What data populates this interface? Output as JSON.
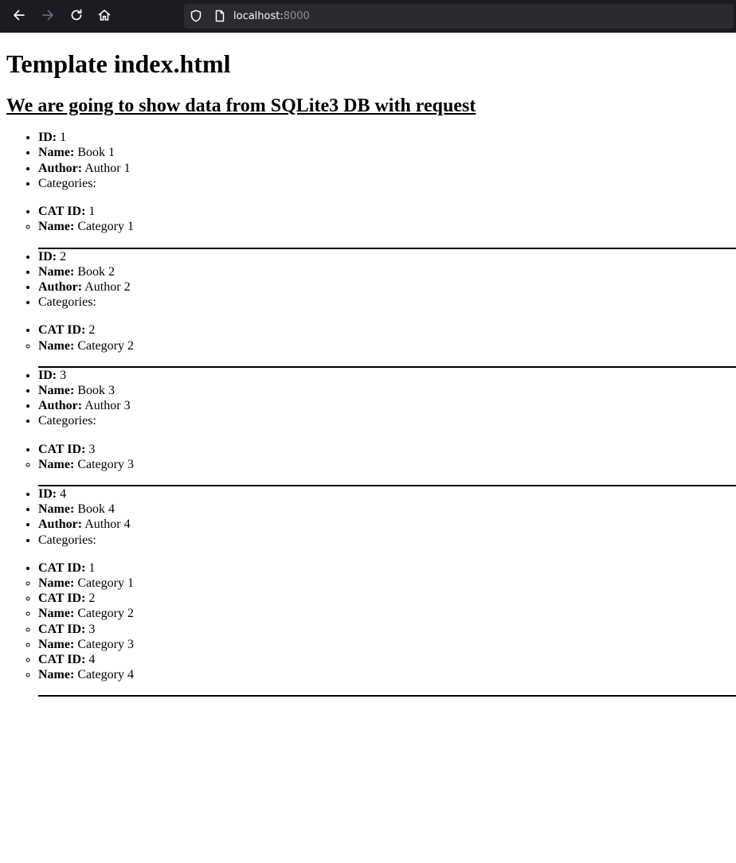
{
  "browser": {
    "url_host": "localhost:",
    "url_port": "8000"
  },
  "page": {
    "title": "Template index.html",
    "subtitle": "We are going to show data from SQLite3 DB with request",
    "labels": {
      "id": "ID:",
      "name": "Name:",
      "author": "Author:",
      "categories": "Categories:",
      "cat_id": "CAT ID:"
    },
    "books": [
      {
        "id": "1",
        "name": "Book 1",
        "author": "Author 1",
        "categories": [
          {
            "cat_id": "1",
            "name": "Category 1"
          }
        ]
      },
      {
        "id": "2",
        "name": "Book 2",
        "author": "Author 2",
        "categories": [
          {
            "cat_id": "2",
            "name": "Category 2"
          }
        ]
      },
      {
        "id": "3",
        "name": "Book 3",
        "author": "Author 3",
        "categories": [
          {
            "cat_id": "3",
            "name": "Category 3"
          }
        ]
      },
      {
        "id": "4",
        "name": "Book 4",
        "author": "Author 4",
        "categories": [
          {
            "cat_id": "1",
            "name": "Category 1"
          },
          {
            "cat_id": "2",
            "name": "Category 2"
          },
          {
            "cat_id": "3",
            "name": "Category 3"
          },
          {
            "cat_id": "4",
            "name": "Category 4"
          }
        ]
      }
    ]
  }
}
